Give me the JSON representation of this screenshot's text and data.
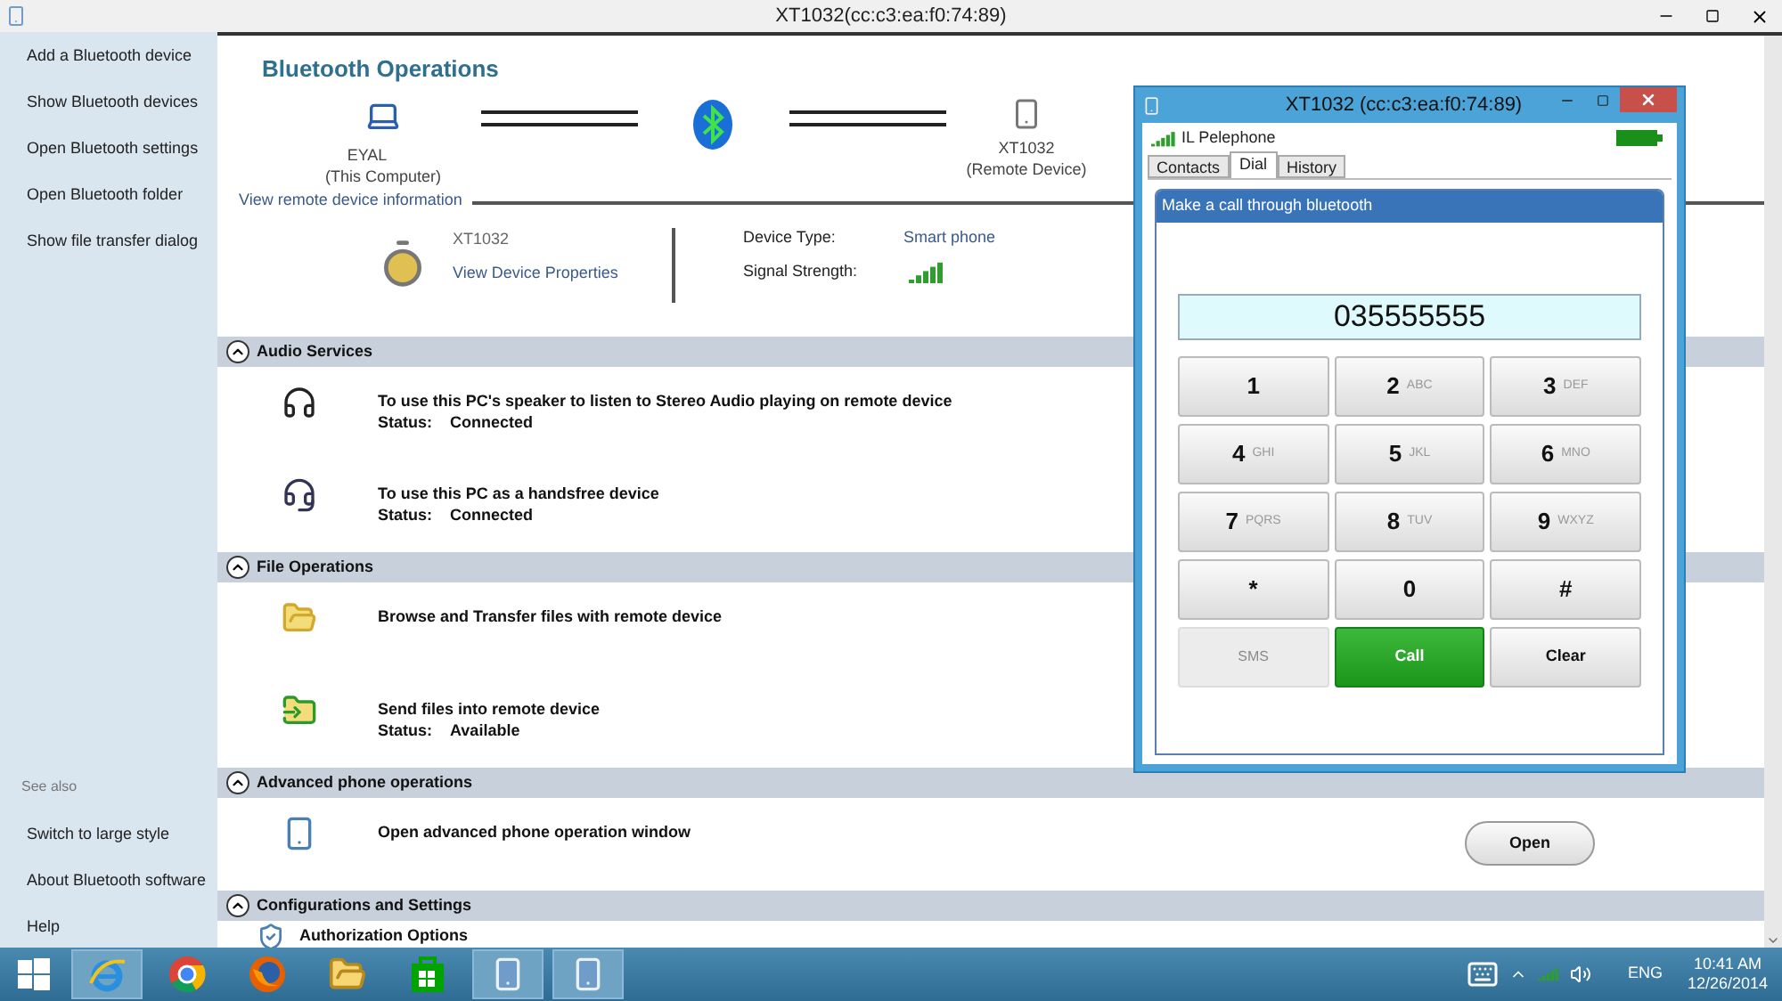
{
  "window": {
    "title": "XT1032(cc:c3:ea:f0:74:89)"
  },
  "sidebar": {
    "items": [
      "Add a Bluetooth device",
      "Show Bluetooth devices",
      "Open Bluetooth settings",
      "Open Bluetooth folder",
      "Show file transfer dialog"
    ],
    "see_also_label": "See also",
    "see_also_items": [
      "Switch to large style",
      "About Bluetooth software",
      "Help"
    ]
  },
  "main": {
    "heading": "Bluetooth Operations",
    "local_device": {
      "name": "EYAL",
      "role": "(This Computer)"
    },
    "remote_device": {
      "name": "XT1032",
      "role": "(Remote Device)"
    },
    "info_link": "View remote device information",
    "device": {
      "name": "XT1032",
      "properties_link": "View Device Properties"
    },
    "details": [
      {
        "label": "Device Type:",
        "kind": "text",
        "value": "Smart phone"
      },
      {
        "label": "Signal Strength:",
        "kind": "signal"
      }
    ],
    "sections": [
      {
        "title": "Audio Services",
        "expanded": true,
        "rows": [
          {
            "kind": "headphones",
            "text": "To use this PC's speaker to listen to Stereo Audio playing on remote device",
            "status_label": "Status:",
            "status": "Connected"
          },
          {
            "kind": "headset",
            "text": "To use this PC as a handsfree device",
            "status_label": "Status:",
            "status": "Connected"
          }
        ]
      },
      {
        "title": "File Operations",
        "expanded": true,
        "rows": [
          {
            "kind": "browse",
            "text": "Browse and Transfer files with remote device"
          },
          {
            "kind": "send",
            "text": "Send files into remote device",
            "status_label": "Status:",
            "status": "Available"
          }
        ]
      },
      {
        "title": "Advanced phone operations",
        "expanded": true,
        "rows": [
          {
            "kind": "phone",
            "text": "Open advanced phone operation window",
            "button": "Open"
          }
        ]
      },
      {
        "title": "Configurations and Settings",
        "expanded": true,
        "rows": [
          {
            "kind": "auth",
            "text": "Authorization Options"
          }
        ]
      }
    ]
  },
  "phone_window": {
    "title": "XT1032 (cc:c3:ea:f0:74:89)",
    "carrier": "IL Pelephone",
    "tabs": [
      {
        "label": "Contacts",
        "selected": false
      },
      {
        "label": "Dial",
        "selected": true
      },
      {
        "label": "History",
        "selected": false
      }
    ],
    "panel_title": "Make a call through bluetooth",
    "number": "035555555",
    "keys": [
      {
        "kind": "digit",
        "digit": "1",
        "disabled": false
      },
      {
        "kind": "digit",
        "digit": "2",
        "letters": "ABC",
        "disabled": false
      },
      {
        "kind": "digit",
        "digit": "3",
        "letters": "DEF",
        "disabled": false
      },
      {
        "kind": "digit",
        "digit": "4",
        "letters": "GHI",
        "disabled": false
      },
      {
        "kind": "digit",
        "digit": "5",
        "letters": "JKL",
        "disabled": false
      },
      {
        "kind": "digit",
        "digit": "6",
        "letters": "MNO",
        "disabled": false
      },
      {
        "kind": "digit",
        "digit": "7",
        "letters": "PQRS",
        "disabled": false
      },
      {
        "kind": "digit",
        "digit": "8",
        "letters": "TUV",
        "disabled": false
      },
      {
        "kind": "digit",
        "digit": "9",
        "letters": "WXYZ",
        "disabled": false
      },
      {
        "kind": "digit",
        "digit": "*",
        "disabled": false
      },
      {
        "kind": "digit",
        "digit": "0",
        "disabled": false
      },
      {
        "kind": "digit",
        "digit": "#",
        "disabled": false
      },
      {
        "kind": "action",
        "digit": "SMS",
        "disabled": true
      },
      {
        "kind": "call",
        "digit": "Call",
        "disabled": false
      },
      {
        "kind": "action",
        "digit": "Clear",
        "disabled": false
      }
    ]
  },
  "taskbar": {
    "apps": [
      {
        "kind": "ie",
        "active": true
      },
      {
        "kind": "chrome",
        "active": false
      },
      {
        "kind": "firefox",
        "active": false
      },
      {
        "kind": "explorer",
        "active": false
      },
      {
        "kind": "store",
        "active": false
      },
      {
        "kind": "phone",
        "active": true
      },
      {
        "kind": "phone",
        "active": true
      }
    ],
    "language": "ENG",
    "time": "10:41 AM",
    "date": "12/26/2014"
  }
}
